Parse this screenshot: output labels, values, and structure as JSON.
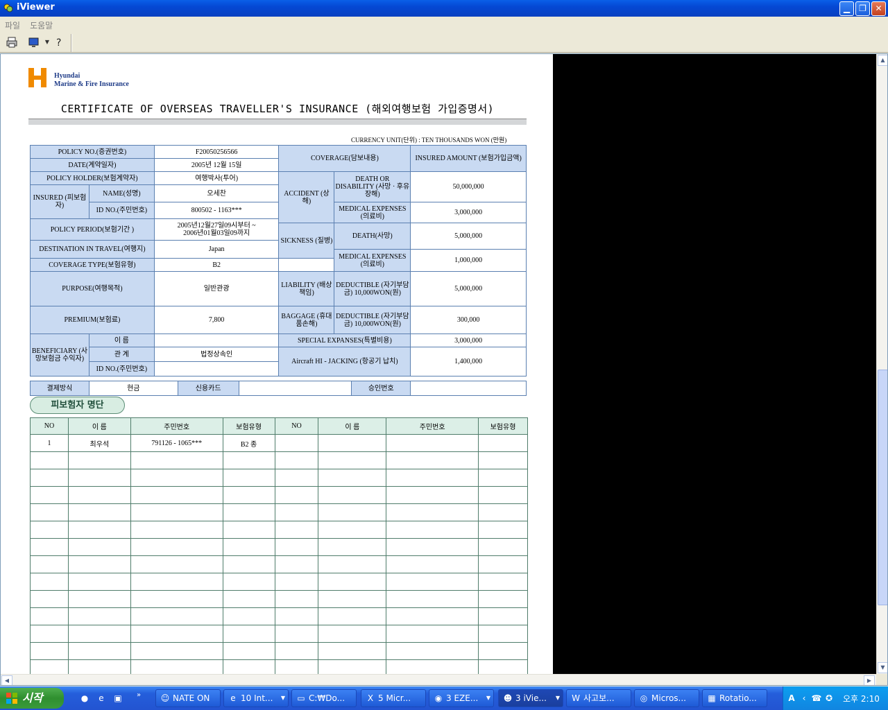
{
  "window": {
    "title": "iViewer",
    "controls": {
      "minimize": "▁",
      "restore": "❐",
      "close": "✕"
    }
  },
  "menu": {
    "file": "파일",
    "help": "도움말"
  },
  "toolbar": {
    "print_icon": "printer-icon",
    "view_icon": "monitor-icon",
    "help_icon": "help-icon"
  },
  "document": {
    "logo": {
      "line1": "Hyundai",
      "line2": "Marine & Fire Insurance"
    },
    "title": "CERTIFICATE OF OVERSEAS TRAVELLER'S INSURANCE (해외여행보험 가입증명서)",
    "currency_unit": "CURRENCY UNIT(단위) : TEN THOUSANDS WON (만원)",
    "left": {
      "policy_no_label": "POLICY NO.(증권번호)",
      "policy_no": "F20050256566",
      "date_label": "DATE(계약일자)",
      "date": "2005년 12월 15일",
      "policy_holder_label": "POLICY HOLDER(보험계약자)",
      "policy_holder": "여행박사(투어)",
      "insured_label": "INSURED (피보험자)",
      "name_label": "NAME(성명)",
      "name": "오세찬",
      "id_label": "ID NO.(주민번호)",
      "id": "800502 - 1163***",
      "period_label": "POLICY PERIOD(보험기간 )",
      "period_line1": "2005년12월27일09시부터 ~",
      "period_line2": "2006년01월03일09까지",
      "destination_label": "DESTINATION IN TRAVEL(여행지)",
      "destination": "Japan",
      "coverage_type_label": "COVERAGE TYPE(보험유형)",
      "coverage_type": "B2",
      "purpose_label": "PURPOSE(여행목적)",
      "purpose": "일반관광",
      "premium_label": "PREMIUM(보험료)",
      "premium": "7,800",
      "beneficiary_label": "BENEFICIARY (사망보험금 수익자)",
      "ben_name_label": "이 름",
      "ben_name": "",
      "ben_rel_label": "관 계",
      "ben_rel": "법정상속인",
      "ben_id_label": "ID NO.(주민번호)",
      "ben_id": ""
    },
    "right": {
      "coverage_label": "COVERAGE(담보내용)",
      "amount_label": "INSURED AMOUNT (보험가입금액)",
      "accident_label": "ACCIDENT (상해)",
      "death_disability_label": "DEATH OR DISABILITY (사망 · 후유장해)",
      "death_disability_amount": "50,000,000",
      "acc_medical_label": "MEDICAL EXPENSES (의료비)",
      "acc_medical_amount": "3,000,000",
      "sickness_label": "SICKNESS (질병)",
      "sick_death_label": "DEATH(사망)",
      "sick_death_amount": "5,000,000",
      "sick_medical_label": "MEDICAL EXPENSES (의료비)",
      "sick_medical_amount": "1,000,000",
      "liability_label": "LIABILITY (배상책임)",
      "liab_deductible_label": "DEDUCTIBLE (자기부담금) 10,000WON(원)",
      "liability_amount": "5,000,000",
      "baggage_label": "BAGGAGE (휴대품손해)",
      "bag_deductible_label": "DEDUCTIBLE (자기부담금) 10,000WON(원)",
      "baggage_amount": "300,000",
      "special_label": "SPECIAL EXPANSES(특별비용)",
      "special_amount": "3,000,000",
      "hijack_label": "Aircraft HI - JACKING (항공기 납치)",
      "hijack_amount": "1,400,000"
    },
    "payment": {
      "method_label": "결제방식",
      "cash": "현금",
      "card": "신용카드",
      "card_value": "",
      "approval_label": "승인번호",
      "approval_value": ""
    },
    "insured_list": {
      "section_title": "피보험자 명단",
      "headers": [
        "NO",
        "이 름",
        "주민번호",
        "보험유형",
        "NO",
        "이 름",
        "주민번호",
        "보험유형"
      ],
      "rows": [
        [
          "1",
          "최우석",
          "791126 - 1065***",
          "B2 종",
          "",
          "",
          "",
          ""
        ]
      ]
    }
  },
  "taskbar": {
    "start": "시작",
    "tasks": [
      {
        "label": "NATE ON",
        "icon": "nate-icon"
      },
      {
        "label": "10 Int...",
        "icon": "ie-icon"
      },
      {
        "label": "C:₩Do...",
        "icon": "folder-icon"
      },
      {
        "label": "5 Micr...",
        "icon": "excel-icon"
      },
      {
        "label": "3 EZE...",
        "icon": "eye-icon"
      },
      {
        "label": "3 iVie...",
        "icon": "iviewer-icon"
      },
      {
        "label": "사고보...",
        "icon": "word-icon"
      },
      {
        "label": "Micros...",
        "icon": "media-icon"
      },
      {
        "label": "Rotatio...",
        "icon": "image-icon"
      }
    ],
    "clock": "오후 2:10",
    "ime": "A"
  }
}
